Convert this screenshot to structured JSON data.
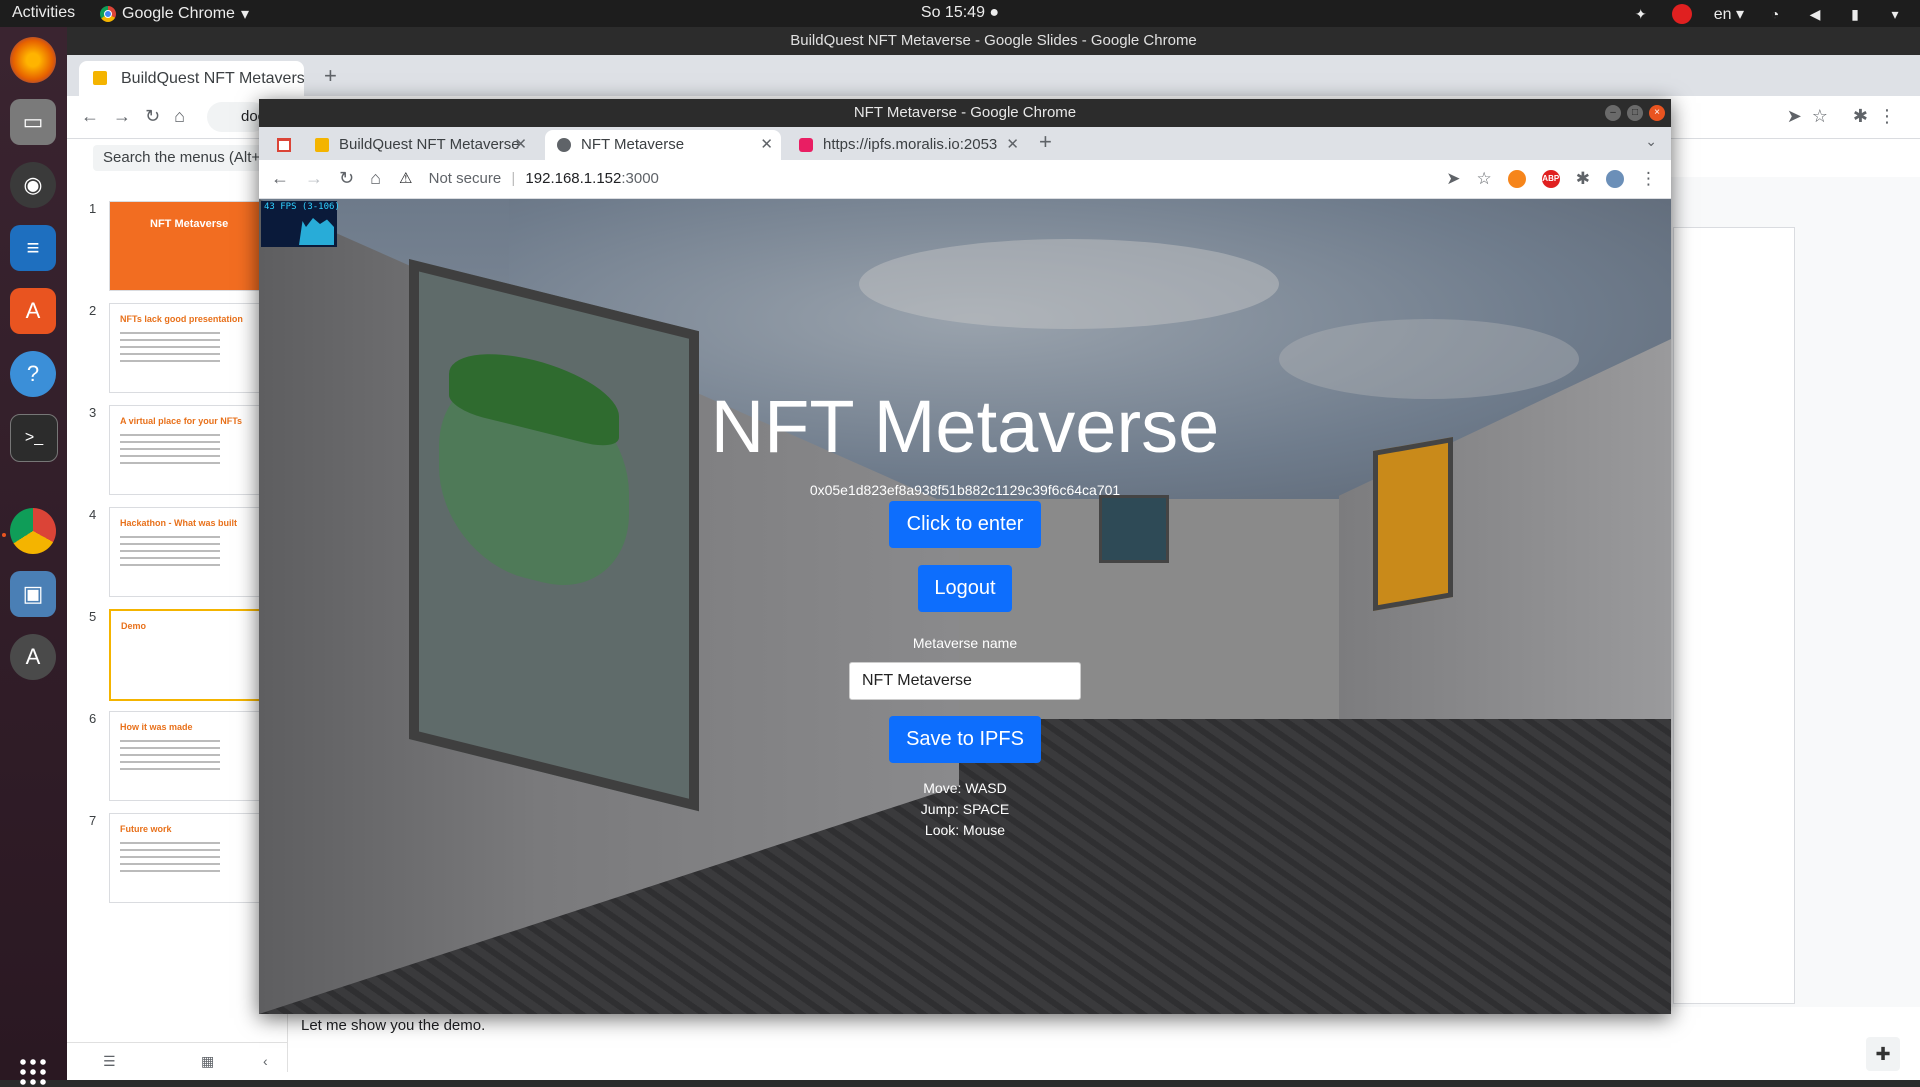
{
  "topbar": {
    "activities": "Activities",
    "app_name": "Google Chrome",
    "clock": "So 15:49",
    "language": "en"
  },
  "dock": {
    "icons": [
      "firefox-icon",
      "files-icon",
      "rhythmbox-icon",
      "writer-icon",
      "software-icon",
      "help-icon",
      "terminal-icon",
      "chrome-icon",
      "shotwell-icon",
      "updater-icon"
    ]
  },
  "bg_window": {
    "title": "BuildQuest NFT Metaverse - Google Slides - Google Chrome",
    "tab_label": "BuildQuest NFT Metaverse",
    "omnibox_text": "doc",
    "search_menus": "Search the menus (Alt+/)",
    "slides": [
      {
        "num": "1",
        "title": "NFT Metaverse"
      },
      {
        "num": "2",
        "title": "NFTs lack good presentation"
      },
      {
        "num": "3",
        "title": "A virtual place for your NFTs"
      },
      {
        "num": "4",
        "title": "Hackathon - What was built"
      },
      {
        "num": "5",
        "title": "Demo"
      },
      {
        "num": "6",
        "title": "How it was made"
      },
      {
        "num": "7",
        "title": "Future work"
      }
    ],
    "speaker_notes": "Let me show you the demo."
  },
  "fg_window": {
    "title": "NFT Metaverse - Google Chrome",
    "tabs": [
      {
        "label": ""
      },
      {
        "label": "BuildQuest NFT Metaverse"
      },
      {
        "label": "NFT Metaverse"
      },
      {
        "label": "https://ipfs.moralis.io:2053"
      }
    ],
    "security_label": "Not secure",
    "url_host": "192.168.1.152",
    "url_port": ":3000"
  },
  "page": {
    "fps_label": "43 FPS (3-106)",
    "heading": "NFT Metaverse",
    "wallet_address": "0x05e1d823ef8a938f51b882c1129c39f6c64ca701",
    "enter_button": "Click to enter",
    "logout_button": "Logout",
    "name_label": "Metaverse name",
    "name_value": "NFT Metaverse",
    "save_button": "Save to IPFS",
    "controls": [
      "Move: WASD",
      "Jump: SPACE",
      "Look: Mouse"
    ]
  },
  "colors": {
    "primary_button": "#0d6efd",
    "ubuntu_accent": "#e95420"
  }
}
